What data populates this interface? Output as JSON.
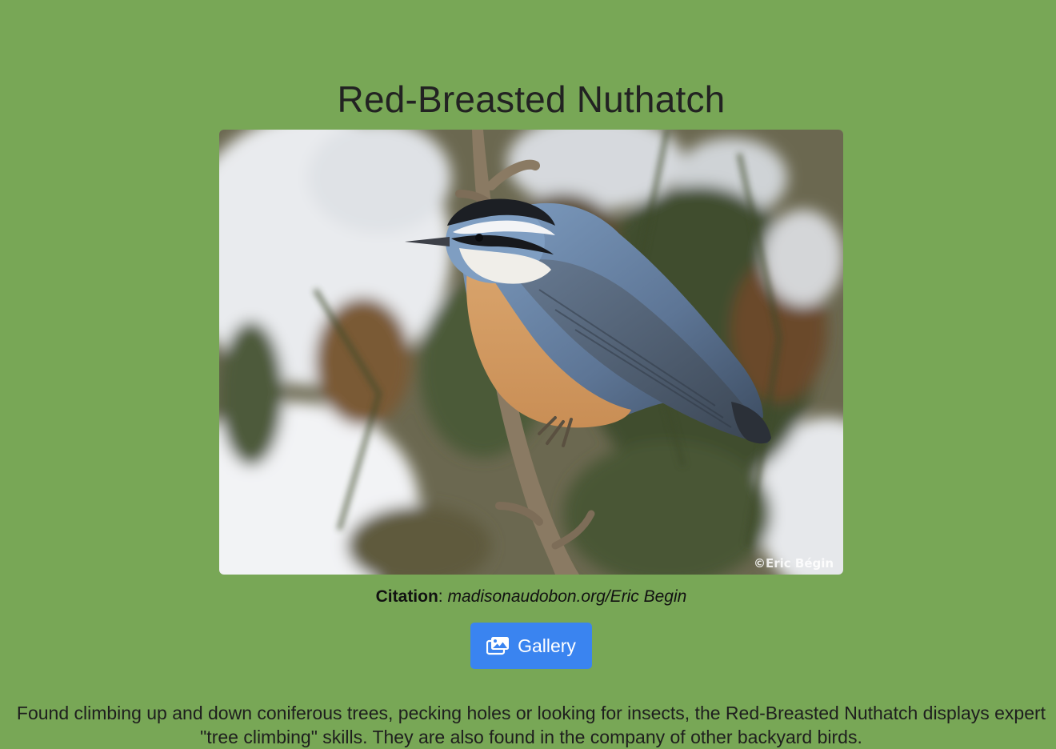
{
  "page": {
    "title": "Red-Breasted Nuthatch"
  },
  "photo": {
    "watermark": "©Eric Bégin"
  },
  "citation": {
    "label": "Citation",
    "separator": ": ",
    "source": "madisonaudobon.org/Eric Begin"
  },
  "gallery_button": {
    "icon": "images-icon",
    "label": "Gallery"
  },
  "description": {
    "text": "Found climbing up and down coniferous trees, pecking holes or looking for insects, the Red-Breasted Nuthatch displays expert \"tree climbing\" skills. They are also found in the company of other backyard birds."
  },
  "colors": {
    "background": "#78a756",
    "button": "#3a84f0"
  }
}
